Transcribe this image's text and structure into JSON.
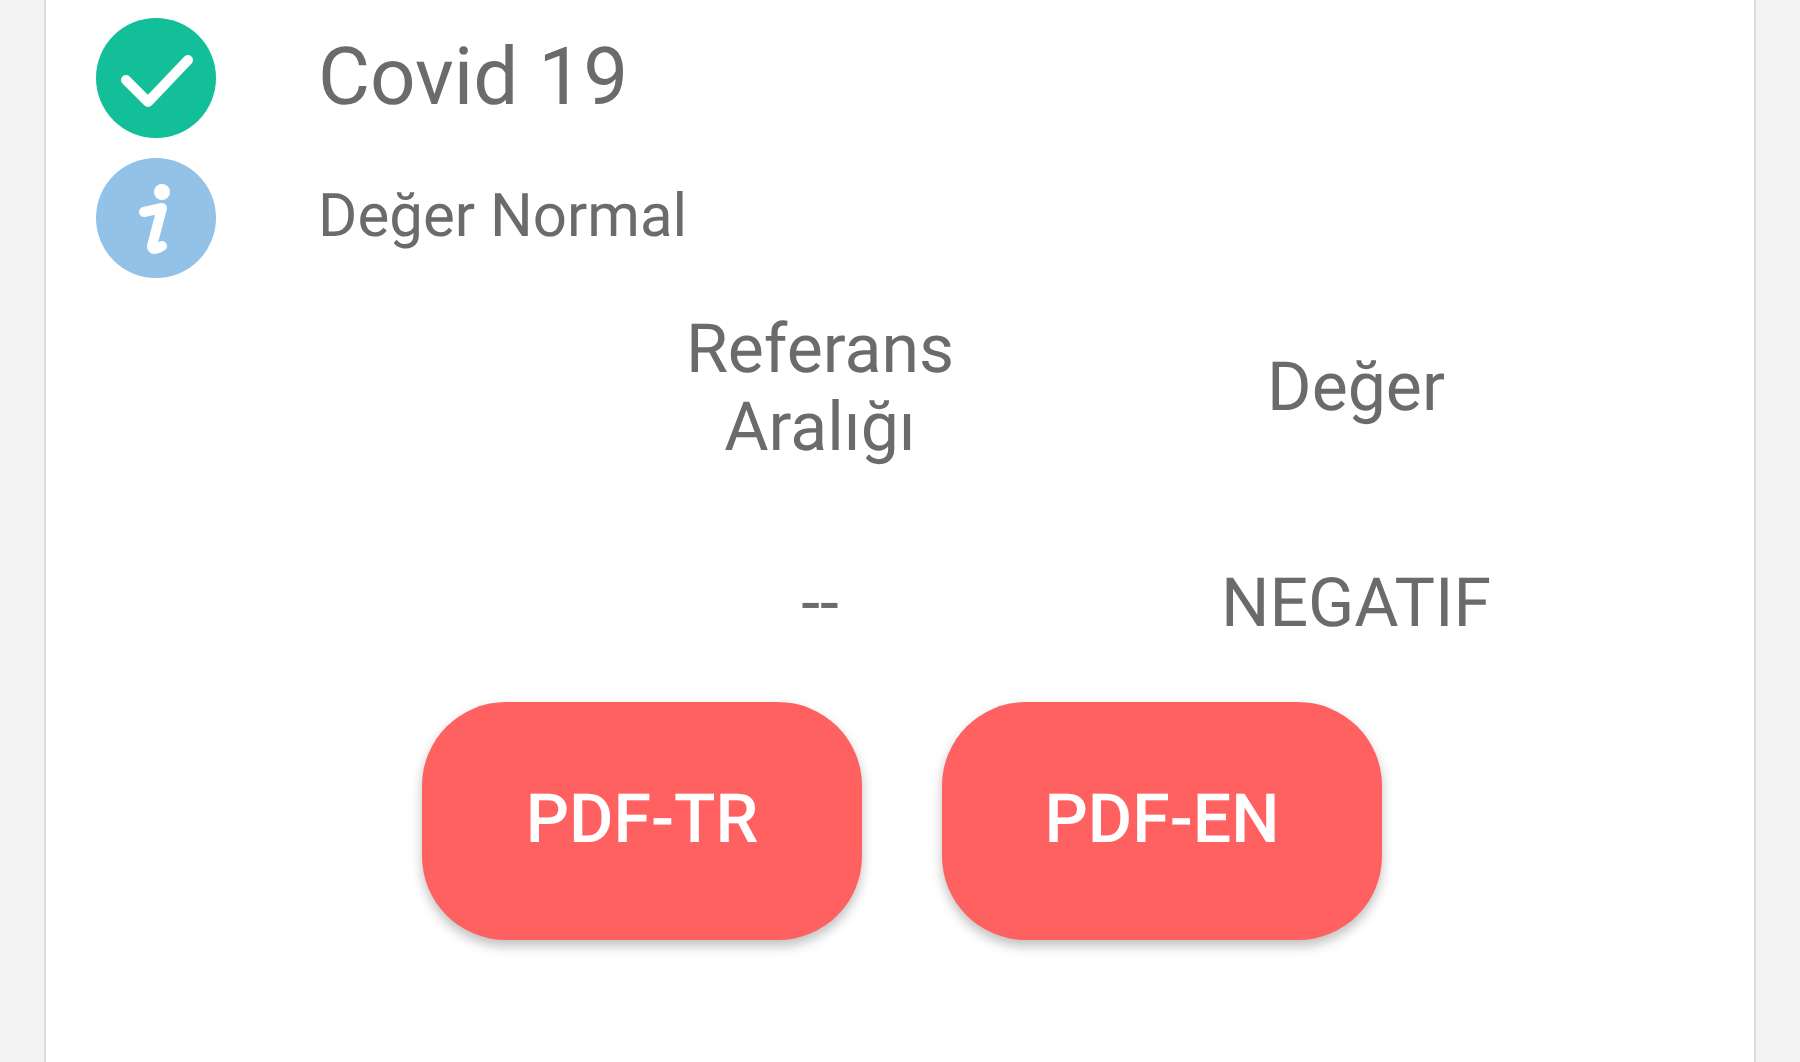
{
  "test": {
    "title": "Covid 19",
    "note": "Değer Normal"
  },
  "table": {
    "columns": [
      "Referans Aralığı",
      "Değer"
    ],
    "rows": [
      [
        "--",
        "NEGATIF"
      ]
    ]
  },
  "buttons": [
    "PDF-TR",
    "PDF-EN"
  ]
}
